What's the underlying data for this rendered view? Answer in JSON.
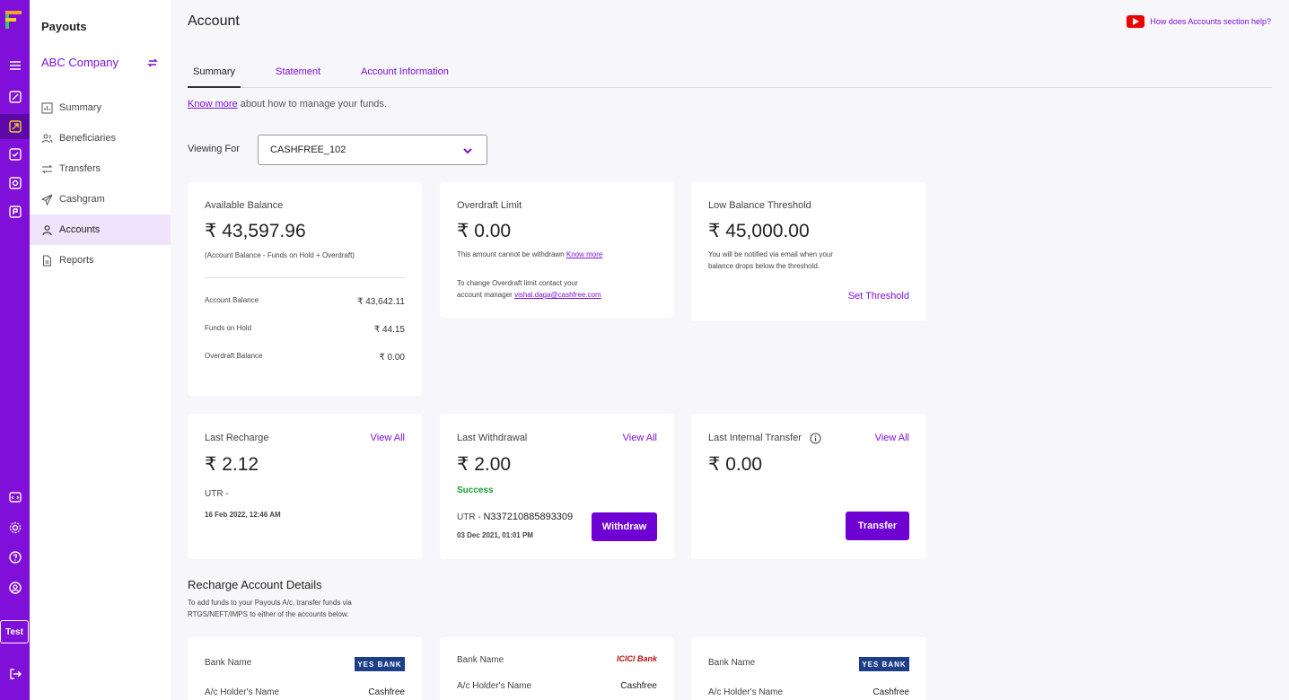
{
  "sidebar": {
    "app_title": "Payouts",
    "company": "ABC Company",
    "items": [
      {
        "label": "Summary",
        "icon": "bar-chart-icon"
      },
      {
        "label": "Beneficiaries",
        "icon": "users-icon"
      },
      {
        "label": "Transfers",
        "icon": "transfer-arrows-icon"
      },
      {
        "label": "Cashgram",
        "icon": "send-icon"
      },
      {
        "label": "Accounts",
        "icon": "user-icon",
        "active": true
      },
      {
        "label": "Reports",
        "icon": "document-icon"
      }
    ],
    "env_label": "Test"
  },
  "header": {
    "title": "Account",
    "help_link": "How does Accounts section help?"
  },
  "tabs": [
    {
      "label": "Summary",
      "active": true
    },
    {
      "label": "Statement"
    },
    {
      "label": "Account Information"
    }
  ],
  "intro": {
    "link": "Know more",
    "text": "about how to manage your funds."
  },
  "viewing": {
    "label": "Viewing For",
    "selected": "CASHFREE_102"
  },
  "available_balance": {
    "label": "Available Balance",
    "amount": "₹ 43,597.96",
    "formula": "(Account Balance - Funds on Hold + Overdraft)",
    "rows": [
      {
        "label": "Account Balance",
        "value": "₹ 43,642.11"
      },
      {
        "label": "Funds on Hold",
        "value": "₹ 44.15"
      },
      {
        "label": "Overdraft Balance",
        "value": "₹ 0.00"
      }
    ]
  },
  "overdraft": {
    "label": "Overdraft Limit",
    "amount": "₹ 0.00",
    "note": "This amount cannot be withdrawn",
    "note_link": "Know more",
    "contact_line1": "To change Overdraft limit contact your",
    "contact_line2": "account manager",
    "email": "vishal.daga@cashfree.com"
  },
  "threshold": {
    "label": "Low Balance Threshold",
    "amount": "₹ 45,000.00",
    "note_line1": "You will be notified via email when your",
    "note_line2": "balance drops below the threshold.",
    "action": "Set Threshold"
  },
  "last_recharge": {
    "label": "Last Recharge",
    "view_all": "View All",
    "amount": "₹ 2.12",
    "utr_label": "UTR -",
    "date": "16 Feb 2022, 12:46 AM"
  },
  "last_withdrawal": {
    "label": "Last Withdrawal",
    "view_all": "View All",
    "amount": "₹ 2.00",
    "status": "Success",
    "utr_label": "UTR -",
    "utr_value": "N337210885893309",
    "date": "03 Dec 2021, 01:01 PM",
    "button": "Withdraw"
  },
  "last_internal": {
    "label": "Last Internal Transfer",
    "view_all": "View All",
    "amount": "₹ 0.00",
    "button": "Transfer"
  },
  "recharge_section": {
    "title": "Recharge Account Details",
    "desc_line1": "To add funds to your Payouts A/c, transfer funds via",
    "desc_line2": "RTGS/NEFT/IMPS to either of the accounts below.",
    "banks": [
      {
        "bank_label": "Bank Name",
        "logo": "YES BANK",
        "holder_label": "A/c Holder's Name",
        "holder": "Cashfree"
      },
      {
        "bank_label": "Bank Name",
        "logo": "ICICI Bank",
        "holder_label": "A/c Holder's Name",
        "holder": "Cashfree"
      },
      {
        "bank_label": "Bank Name",
        "logo": "YES BANK",
        "holder_label": "A/c Holder's Name",
        "holder": "Cashfree"
      }
    ]
  },
  "colors": {
    "brand": "#7f0fd9",
    "button": "#6e00d4",
    "success": "#1a9c2e"
  }
}
